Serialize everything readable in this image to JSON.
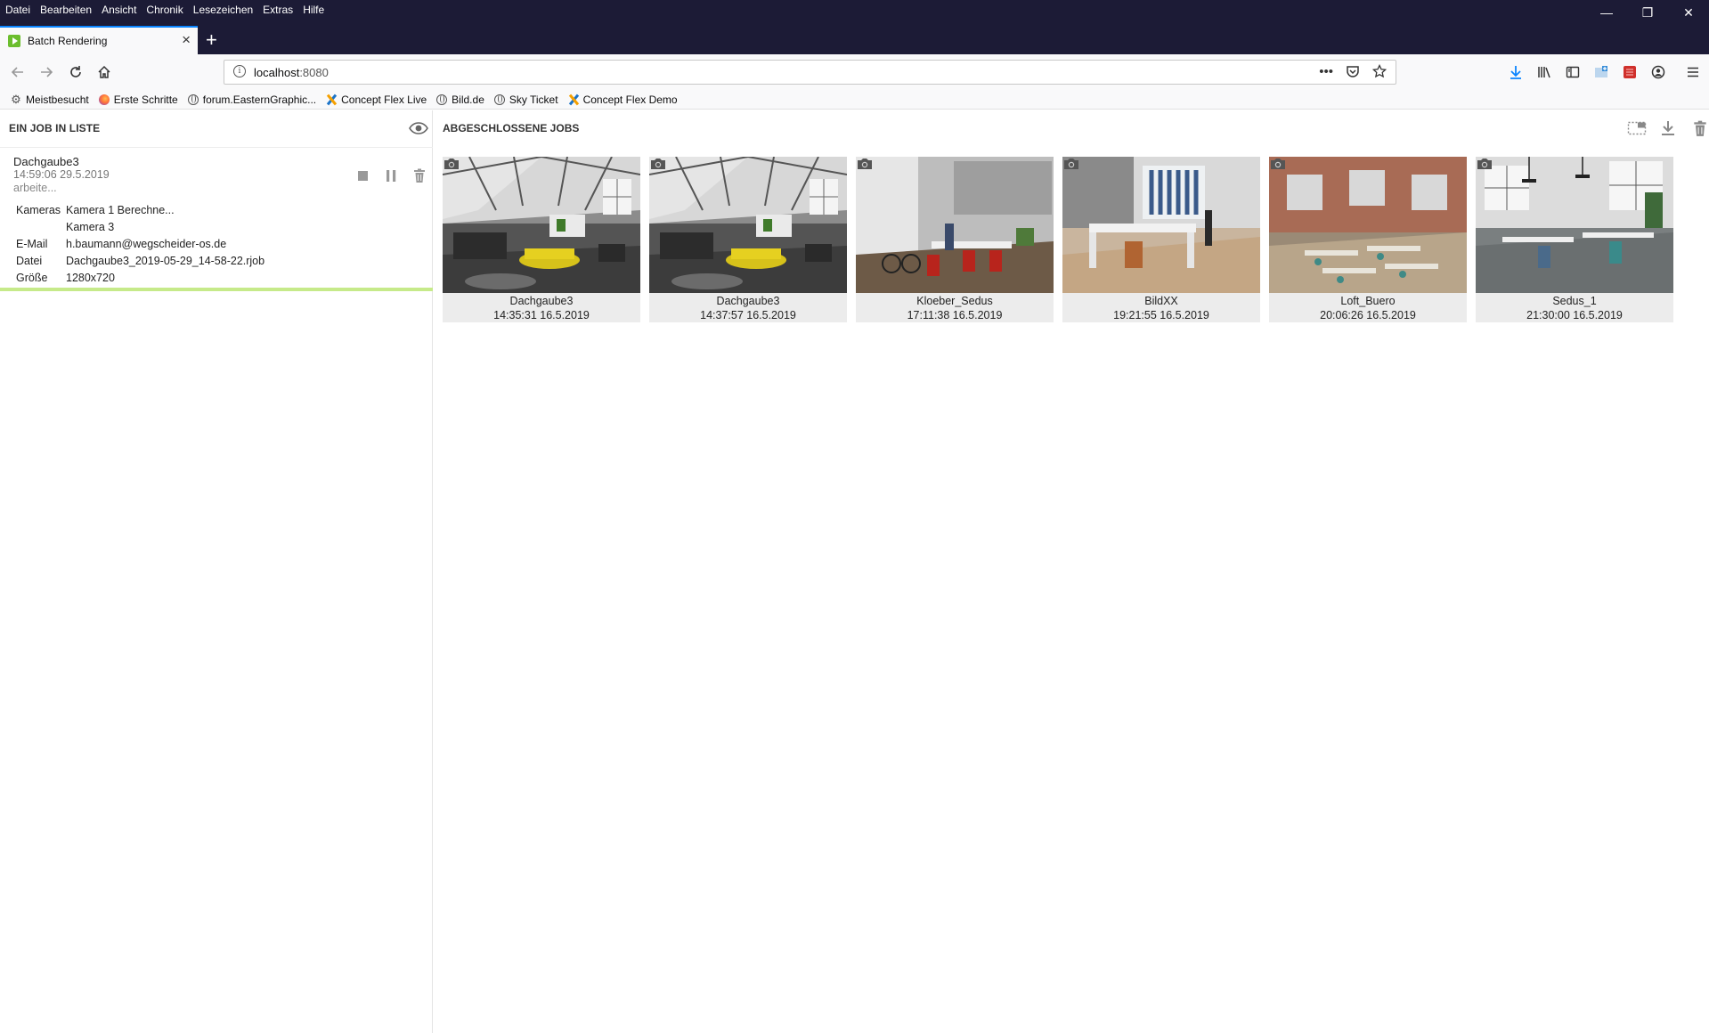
{
  "menu": [
    "Datei",
    "Bearbeiten",
    "Ansicht",
    "Chronik",
    "Lesezeichen",
    "Extras",
    "Hilfe"
  ],
  "tab": {
    "title": "Batch Rendering"
  },
  "url": {
    "host": "localhost",
    "port": ":8080"
  },
  "bookmarks": [
    {
      "label": "Meistbesucht",
      "icon": "gear-icon"
    },
    {
      "label": "Erste Schritte",
      "icon": "firefox-icon"
    },
    {
      "label": "forum.EasternGraphic...",
      "icon": "globe-icon"
    },
    {
      "label": "Concept Flex Live",
      "icon": "concept-flex-icon"
    },
    {
      "label": "Bild.de",
      "icon": "globe-icon"
    },
    {
      "label": "Sky Ticket",
      "icon": "globe-icon"
    },
    {
      "label": "Concept Flex Demo",
      "icon": "concept-flex-icon"
    }
  ],
  "queue": {
    "heading": "EIN JOB IN LISTE",
    "job": {
      "name": "Dachgaube3",
      "time": "14:59:06 29.5.2019",
      "status": "arbeite...",
      "progress": 1.0,
      "details": [
        {
          "label": "Kameras",
          "value": "Kamera 1 Berechne..."
        },
        {
          "label": "",
          "value": "Kamera 3"
        },
        {
          "label": "E-Mail",
          "value": "h.baumann@wegscheider-os.de"
        },
        {
          "label": "Datei",
          "value": "Dachgaube3_2019-05-29_14-58-22.rjob"
        },
        {
          "label": "Größe",
          "value": "1280x720"
        }
      ]
    }
  },
  "completed": {
    "heading": "ABGESCHLOSSENE JOBS",
    "jobs": [
      {
        "name": "Dachgaube3",
        "time": "14:35:31 16.5.2019"
      },
      {
        "name": "Dachgaube3",
        "time": "14:37:57 16.5.2019"
      },
      {
        "name": "Kloeber_Sedus",
        "time": "17:11:38 16.5.2019"
      },
      {
        "name": "BildXX",
        "time": "19:21:55 16.5.2019"
      },
      {
        "name": "Loft_Buero",
        "time": "20:06:26 16.5.2019"
      },
      {
        "name": "Sedus_1",
        "time": "21:30:00 16.5.2019"
      }
    ]
  },
  "colors": {
    "titlebar": "#1c1b36",
    "tab_accent": "#0a84ff",
    "progress": "#c6ea8a"
  }
}
